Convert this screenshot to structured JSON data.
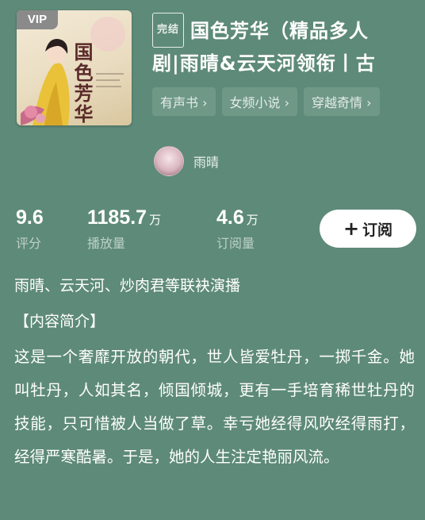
{
  "cover": {
    "vip_label": "VIP",
    "cover_title": "国色芳华"
  },
  "book": {
    "status_badge": "完结",
    "title_line1": "国色芳华（精品多人",
    "title_line2": "剧|雨晴&云天河领衔丨古"
  },
  "tags": [
    {
      "label": "有声书 ›"
    },
    {
      "label": "女频小说 ›"
    },
    {
      "label": "穿越奇情 ›"
    }
  ],
  "author": {
    "name": "雨晴"
  },
  "stats": {
    "rating": {
      "value": "9.6",
      "label": "评分"
    },
    "plays": {
      "value": "1185.7",
      "unit": "万",
      "label": "播放量"
    },
    "subs": {
      "value": "4.6",
      "unit": "万",
      "label": "订阅量"
    }
  },
  "subscribe": {
    "plus": "+",
    "label": "订阅"
  },
  "cast_line": "雨晴、云天河、炒肉君等联袂演播",
  "section_title": "【内容简介】",
  "intro": "这是一个奢靡开放的朝代，世人皆爱牡丹，一掷千金。她叫牡丹，人如其名，倾国倾城，更有一手培育稀世牡丹的技能，只可惜被人当做了草。幸亏她经得风吹经得雨打，经得严寒酷暑。于是，她的人生注定艳丽风流。"
}
